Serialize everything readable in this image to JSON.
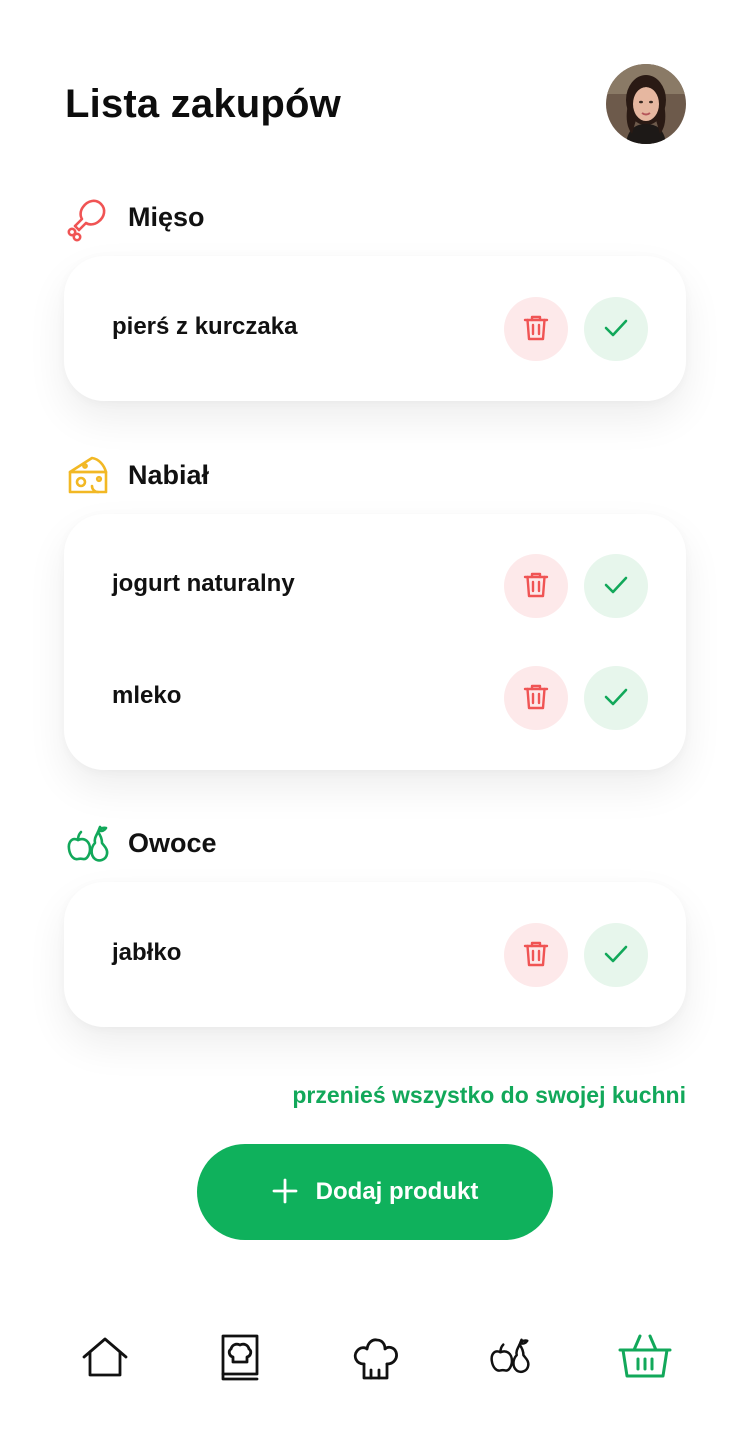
{
  "header": {
    "title": "Lista zakupów",
    "avatar_alt": "profile photo"
  },
  "categories": [
    {
      "title": "Mięso",
      "icon": "drumstick-icon",
      "items": [
        {
          "name": "pierś z kurczaka"
        }
      ]
    },
    {
      "title": "Nabiał",
      "icon": "cheese-icon",
      "items": [
        {
          "name": "jogurt naturalny"
        },
        {
          "name": "mleko"
        }
      ]
    },
    {
      "title": "Owoce",
      "icon": "fruits-icon",
      "items": [
        {
          "name": "jabłko"
        }
      ]
    }
  ],
  "actions": {
    "move_all": "przenieś wszystko do swojej kuchni",
    "add_product": "Dodaj produkt"
  },
  "nav": [
    {
      "icon": "home-icon",
      "active": false
    },
    {
      "icon": "recipe-book-icon",
      "active": false
    },
    {
      "icon": "chef-hat-icon",
      "active": false
    },
    {
      "icon": "fruits-icon",
      "active": false
    },
    {
      "icon": "basket-icon",
      "active": true
    }
  ],
  "colors": {
    "accent_green": "#0fb15c",
    "delete_red": "#f05454",
    "delete_bg": "#fde9ea",
    "check_green": "#12a85a",
    "check_bg": "#e7f6ec",
    "cheese_yellow": "#f2b824"
  }
}
